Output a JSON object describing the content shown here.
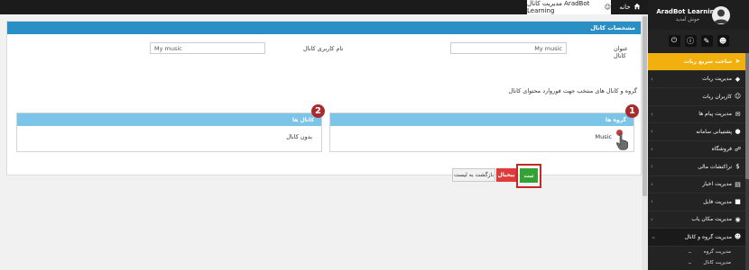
{
  "topbar": {
    "home_tab": "خانه",
    "active_tab": "مدیریت کانال AradBot Learning"
  },
  "panel": {
    "title": "مشخصات کانال",
    "channel_title_label": "عنوان کانال",
    "channel_title_value": "My music",
    "channel_username_label": "نام کاربری کانال",
    "channel_username_value": "My music",
    "description": "گروه و کانال های منتخب جهت فوروارد محتوای کانال"
  },
  "groups_box": {
    "header": "گروه ها",
    "item": "Music",
    "badge": "1"
  },
  "channels_box": {
    "header": "کانال ها",
    "empty": "بدون کانال",
    "badge": "2"
  },
  "buttons": {
    "back": "بازگشت به لیست",
    "cancel": "بیخیال",
    "save": "ثبت"
  },
  "sidebar": {
    "profile_name": "AradBot Learning",
    "profile_sub": "خوش آمدید",
    "menu": [
      {
        "label": "ساخت سریع ربات",
        "icon": "rocket-icon",
        "active": true
      },
      {
        "label": "مدیریت ربات",
        "icon": "cube-icon"
      },
      {
        "label": "کاربران ربات",
        "icon": "users-icon"
      },
      {
        "label": "مدیریت پیام ها",
        "icon": "envelope-icon"
      },
      {
        "label": "پشتیبانی سامانه",
        "icon": "support-icon"
      },
      {
        "label": "فروشگاه",
        "icon": "cart-icon"
      },
      {
        "label": "تراکنشات مالی",
        "icon": "money-icon"
      },
      {
        "label": "مدیریت اخبار",
        "icon": "news-icon"
      },
      {
        "label": "مدیریت فایل",
        "icon": "folder-icon"
      },
      {
        "label": "مدیریت مکان یاب",
        "icon": "location-icon"
      },
      {
        "label": "مدیریت گروه و کانال",
        "icon": "group-icon",
        "open": true
      }
    ],
    "submenu": [
      "مدیریت گروه",
      "مدیریت کانال"
    ]
  },
  "colors": {
    "panel_header": "#2a8fc4",
    "box_header": "#7cc4e8",
    "active_menu": "#f2b00f",
    "save_button": "#33a133",
    "cancel_button": "#de3b3b",
    "badge": "#a82a2a"
  }
}
